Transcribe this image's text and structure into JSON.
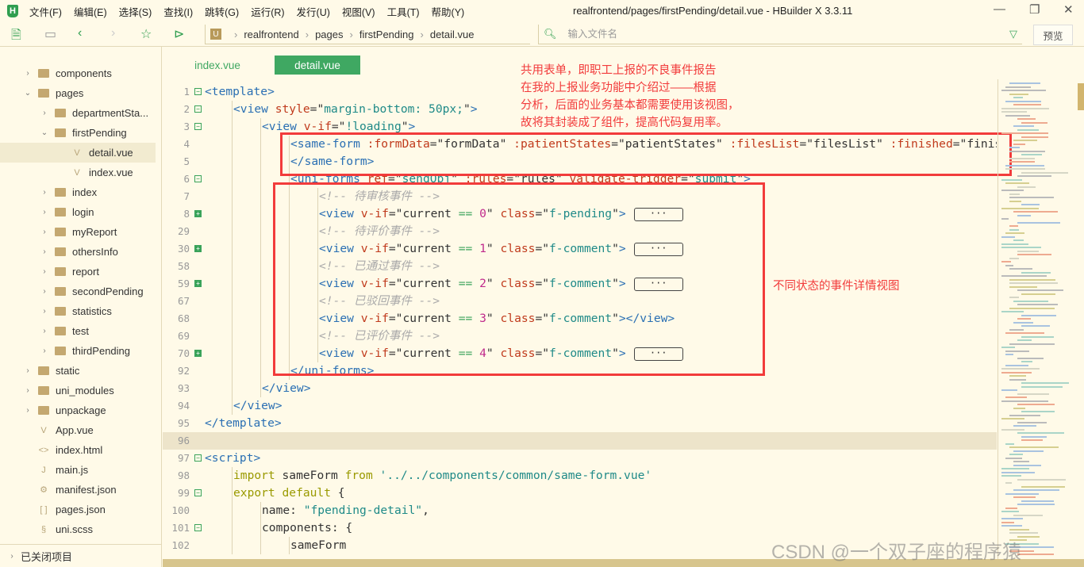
{
  "app": {
    "title": "realfrontend/pages/firstPending/detail.vue - HBuilder X 3.3.11",
    "logo": "H"
  },
  "menu": [
    "文件(F)",
    "编辑(E)",
    "选择(S)",
    "查找(I)",
    "跳转(G)",
    "运行(R)",
    "发行(U)",
    "视图(V)",
    "工具(T)",
    "帮助(Y)"
  ],
  "breadcrumb": [
    "realfrontend",
    "pages",
    "firstPending",
    "detail.vue"
  ],
  "search": {
    "placeholder": "输入文件名"
  },
  "preview_label": "预览",
  "tree": [
    {
      "label": "components",
      "type": "folder",
      "depth": 1,
      "chev": "›"
    },
    {
      "label": "pages",
      "type": "folder",
      "depth": 1,
      "chev": "⌄"
    },
    {
      "label": "departmentSta...",
      "type": "folder",
      "depth": 2,
      "chev": "›"
    },
    {
      "label": "firstPending",
      "type": "folder",
      "depth": 2,
      "chev": "⌄"
    },
    {
      "label": "detail.vue",
      "type": "vue",
      "depth": 3,
      "selected": true
    },
    {
      "label": "index.vue",
      "type": "vue",
      "depth": 3
    },
    {
      "label": "index",
      "type": "folder",
      "depth": 2,
      "chev": "›"
    },
    {
      "label": "login",
      "type": "folder",
      "depth": 2,
      "chev": "›"
    },
    {
      "label": "myReport",
      "type": "folder",
      "depth": 2,
      "chev": "›"
    },
    {
      "label": "othersInfo",
      "type": "folder",
      "depth": 2,
      "chev": "›"
    },
    {
      "label": "report",
      "type": "folder",
      "depth": 2,
      "chev": "›"
    },
    {
      "label": "secondPending",
      "type": "folder",
      "depth": 2,
      "chev": "›"
    },
    {
      "label": "statistics",
      "type": "folder",
      "depth": 2,
      "chev": "›"
    },
    {
      "label": "test",
      "type": "folder",
      "depth": 2,
      "chev": "›"
    },
    {
      "label": "thirdPending",
      "type": "folder",
      "depth": 2,
      "chev": "›"
    },
    {
      "label": "static",
      "type": "folder",
      "depth": 1,
      "chev": "›"
    },
    {
      "label": "uni_modules",
      "type": "folder",
      "depth": 1,
      "chev": "›"
    },
    {
      "label": "unpackage",
      "type": "folder",
      "depth": 1,
      "chev": "›"
    },
    {
      "label": "App.vue",
      "type": "vue",
      "depth": 1
    },
    {
      "label": "index.html",
      "type": "html",
      "depth": 1
    },
    {
      "label": "main.js",
      "type": "js",
      "depth": 1
    },
    {
      "label": "manifest.json",
      "type": "manifest",
      "depth": 1
    },
    {
      "label": "pages.json",
      "type": "json",
      "depth": 1
    },
    {
      "label": "uni.scss",
      "type": "scss",
      "depth": 1
    }
  ],
  "closed_projects": "已关闭项目",
  "tabs": [
    {
      "label": "index.vue",
      "active": false
    },
    {
      "label": "detail.vue",
      "active": true
    }
  ],
  "colors": {
    "accent": "#3fa862",
    "annotation": "#f23b3b"
  },
  "code": [
    {
      "n": "1",
      "fold": "minus",
      "ind": 0,
      "t": [
        [
          "tag",
          "<template>"
        ]
      ]
    },
    {
      "n": "2",
      "fold": "minus",
      "ind": 1,
      "t": [
        [
          "tag",
          "<view "
        ],
        [
          "attr",
          "style"
        ],
        [
          "plain",
          "=\""
        ],
        [
          "str",
          "margin-bottom: 50px;"
        ],
        [
          "plain",
          "\""
        ],
        [
          "tag",
          ">"
        ]
      ]
    },
    {
      "n": "3",
      "fold": "minus",
      "ind": 2,
      "t": [
        [
          "tag",
          "<view "
        ],
        [
          "attr",
          "v-if"
        ],
        [
          "plain",
          "=\""
        ],
        [
          "str",
          "!loading"
        ],
        [
          "plain",
          "\""
        ],
        [
          "tag",
          ">"
        ]
      ]
    },
    {
      "n": "4",
      "ind": 3,
      "t": [
        [
          "tag",
          "<same-form "
        ],
        [
          "attr",
          ":formData"
        ],
        [
          "plain",
          "=\"formData\" "
        ],
        [
          "attr",
          ":patientStates"
        ],
        [
          "plain",
          "=\"patientStates\" "
        ],
        [
          "attr",
          ":filesList"
        ],
        [
          "plain",
          "=\"filesList\" "
        ],
        [
          "attr",
          ":finished"
        ],
        [
          "plain",
          "=\"finished\""
        ]
      ]
    },
    {
      "n": "5",
      "ind": 3,
      "t": [
        [
          "tag",
          "</same-form>"
        ]
      ]
    },
    {
      "n": "6",
      "fold": "minus",
      "ind": 3,
      "t": [
        [
          "tag",
          "<uni-forms "
        ],
        [
          "attr",
          "ref"
        ],
        [
          "plain",
          "=\""
        ],
        [
          "str",
          "sendObj"
        ],
        [
          "plain",
          "\" "
        ],
        [
          "attr",
          ":rules"
        ],
        [
          "plain",
          "=\"rules\" "
        ],
        [
          "attr",
          "validate-trigger"
        ],
        [
          "plain",
          "=\""
        ],
        [
          "str",
          "submit"
        ],
        [
          "plain",
          "\""
        ],
        [
          "tag",
          ">"
        ]
      ]
    },
    {
      "n": "7",
      "ind": 4,
      "t": [
        [
          "com",
          "<!-- 待审核事件 -->"
        ]
      ]
    },
    {
      "n": "8",
      "fold": "plus",
      "ind": 4,
      "ell": true,
      "t": [
        [
          "tag",
          "<view "
        ],
        [
          "attr",
          "v-if"
        ],
        [
          "plain",
          "=\"current "
        ],
        [
          "op",
          "=="
        ],
        [
          "plain",
          " "
        ],
        [
          "num",
          "0"
        ],
        [
          "plain",
          "\" "
        ],
        [
          "attr",
          "class"
        ],
        [
          "plain",
          "=\""
        ],
        [
          "str",
          "f-pending"
        ],
        [
          "plain",
          "\""
        ],
        [
          "tag",
          ">"
        ]
      ]
    },
    {
      "n": "29",
      "ind": 4,
      "t": [
        [
          "com",
          "<!-- 待评价事件 -->"
        ]
      ]
    },
    {
      "n": "30",
      "fold": "plus",
      "ind": 4,
      "ell": true,
      "t": [
        [
          "tag",
          "<view "
        ],
        [
          "attr",
          "v-if"
        ],
        [
          "plain",
          "=\"current "
        ],
        [
          "op",
          "=="
        ],
        [
          "plain",
          " "
        ],
        [
          "num",
          "1"
        ],
        [
          "plain",
          "\" "
        ],
        [
          "attr",
          "class"
        ],
        [
          "plain",
          "=\""
        ],
        [
          "str",
          "f-comment"
        ],
        [
          "plain",
          "\""
        ],
        [
          "tag",
          ">"
        ]
      ]
    },
    {
      "n": "58",
      "ind": 4,
      "t": [
        [
          "com",
          "<!-- 已通过事件 -->"
        ]
      ]
    },
    {
      "n": "59",
      "fold": "plus",
      "ind": 4,
      "ell": true,
      "t": [
        [
          "tag",
          "<view "
        ],
        [
          "attr",
          "v-if"
        ],
        [
          "plain",
          "=\"current "
        ],
        [
          "op",
          "=="
        ],
        [
          "plain",
          " "
        ],
        [
          "num",
          "2"
        ],
        [
          "plain",
          "\" "
        ],
        [
          "attr",
          "class"
        ],
        [
          "plain",
          "=\""
        ],
        [
          "str",
          "f-comment"
        ],
        [
          "plain",
          "\""
        ],
        [
          "tag",
          ">"
        ]
      ]
    },
    {
      "n": "67",
      "ind": 4,
      "t": [
        [
          "com",
          "<!-- 已驳回事件 -->"
        ]
      ]
    },
    {
      "n": "68",
      "ind": 4,
      "t": [
        [
          "tag",
          "<view "
        ],
        [
          "attr",
          "v-if"
        ],
        [
          "plain",
          "=\"current "
        ],
        [
          "op",
          "=="
        ],
        [
          "plain",
          " "
        ],
        [
          "num",
          "3"
        ],
        [
          "plain",
          "\" "
        ],
        [
          "attr",
          "class"
        ],
        [
          "plain",
          "=\""
        ],
        [
          "str",
          "f-comment"
        ],
        [
          "plain",
          "\""
        ],
        [
          "tag",
          "></view>"
        ]
      ]
    },
    {
      "n": "69",
      "ind": 4,
      "t": [
        [
          "com",
          "<!-- 已评价事件 -->"
        ]
      ]
    },
    {
      "n": "70",
      "fold": "plus",
      "ind": 4,
      "ell": true,
      "t": [
        [
          "tag",
          "<view "
        ],
        [
          "attr",
          "v-if"
        ],
        [
          "plain",
          "=\"current "
        ],
        [
          "op",
          "=="
        ],
        [
          "plain",
          " "
        ],
        [
          "num",
          "4"
        ],
        [
          "plain",
          "\" "
        ],
        [
          "attr",
          "class"
        ],
        [
          "plain",
          "=\""
        ],
        [
          "str",
          "f-comment"
        ],
        [
          "plain",
          "\""
        ],
        [
          "tag",
          ">"
        ]
      ]
    },
    {
      "n": "92",
      "ind": 3,
      "t": [
        [
          "tag",
          "</uni-forms>"
        ]
      ]
    },
    {
      "n": "93",
      "ind": 2,
      "t": [
        [
          "tag",
          "</view>"
        ]
      ]
    },
    {
      "n": "94",
      "ind": 1,
      "t": [
        [
          "tag",
          "</view>"
        ]
      ]
    },
    {
      "n": "95",
      "ind": 0,
      "t": [
        [
          "tag",
          "</template>"
        ]
      ]
    },
    {
      "n": "96",
      "ind": 0,
      "cur": true,
      "t": []
    },
    {
      "n": "97",
      "fold": "minus",
      "ind": 0,
      "t": [
        [
          "tag",
          "<script>"
        ]
      ]
    },
    {
      "n": "98",
      "ind": 1,
      "t": [
        [
          "kw",
          "import "
        ],
        [
          "plain",
          "sameForm "
        ],
        [
          "kw",
          "from "
        ],
        [
          "str",
          "'../../components/common/same-form.vue'"
        ]
      ]
    },
    {
      "n": "99",
      "fold": "minus",
      "ind": 1,
      "t": [
        [
          "kw",
          "export default "
        ],
        [
          "plain",
          "{"
        ]
      ]
    },
    {
      "n": "100",
      "ind": 2,
      "t": [
        [
          "plain",
          "name: "
        ],
        [
          "str",
          "\"fpending-detail\""
        ],
        [
          "plain",
          ","
        ]
      ]
    },
    {
      "n": "101",
      "fold": "minus",
      "ind": 2,
      "t": [
        [
          "plain",
          "components: {"
        ]
      ]
    },
    {
      "n": "102",
      "ind": 3,
      "t": [
        [
          "plain",
          "sameForm"
        ]
      ]
    }
  ],
  "ellipsis": "···",
  "annotations": {
    "top": [
      "共用表单，即职工上报的不良事件报告",
      "在我的上报业务功能中介绍过——根据",
      "分析，后面的业务基本都需要使用该视图，",
      "故将其封装成了组件，提高代码复用率。"
    ],
    "right": "不同状态的事件详情视图"
  },
  "watermark": "CSDN @一个双子座的程序猿"
}
